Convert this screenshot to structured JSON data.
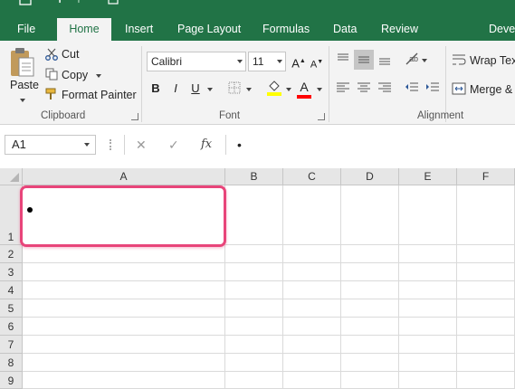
{
  "ribbon_tabs": [
    "File",
    "Home",
    "Insert",
    "Page Layout",
    "Formulas",
    "Data",
    "Review",
    "Devel"
  ],
  "active_tab": "Home",
  "clipboard": {
    "paste_label": "Paste",
    "cut_label": "Cut",
    "copy_label": "Copy",
    "format_painter_label": "Format Painter",
    "group_label": "Clipboard"
  },
  "font": {
    "font_name": "Calibri",
    "font_size": "11",
    "bold": "B",
    "italic": "I",
    "underline": "U",
    "group_label": "Font"
  },
  "alignment": {
    "wrap_text_label": "Wrap Text",
    "merge_label": "Merge &",
    "group_label": "Alignment"
  },
  "formula_bar": {
    "name_box": "A1",
    "fx_label": "fx",
    "cancel_glyph": "✕",
    "enter_glyph": "✓",
    "content": "•"
  },
  "columns": [
    "A",
    "B",
    "C",
    "D",
    "E",
    "F"
  ],
  "rows": [
    "1",
    "2",
    "3",
    "4",
    "5",
    "6",
    "7",
    "8",
    "9"
  ],
  "colors": {
    "brand": "#217346",
    "highlight": "#e8457a",
    "font_color_bar": "#ff0000",
    "fill_color_bar": "#ffff00"
  }
}
